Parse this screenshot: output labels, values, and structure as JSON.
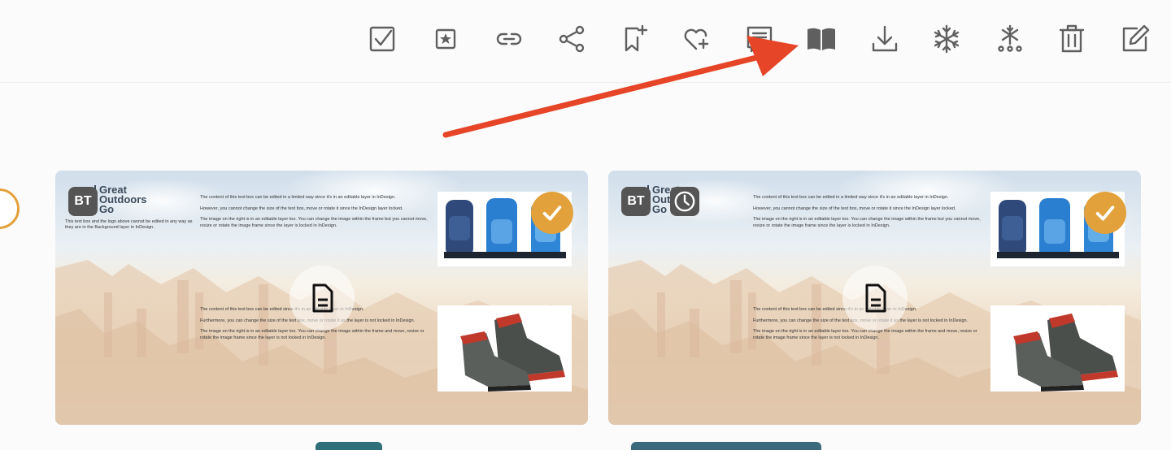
{
  "toolbar": {
    "icons": [
      {
        "name": "select-checkbox-icon"
      },
      {
        "name": "favorite-star-icon"
      },
      {
        "name": "link-icon"
      },
      {
        "name": "share-icon"
      },
      {
        "name": "add-to-collection-icon"
      },
      {
        "name": "add-to-favorites-icon"
      },
      {
        "name": "details-list-icon"
      },
      {
        "name": "open-book-icon"
      },
      {
        "name": "download-icon"
      },
      {
        "name": "freeze-icon"
      },
      {
        "name": "unfreeze-icon"
      },
      {
        "name": "delete-trash-icon"
      },
      {
        "name": "edit-icon"
      }
    ],
    "icon_color": "#5f5f5f"
  },
  "annotation": {
    "arrow_color": "#e64527",
    "points_to": "open-book-icon"
  },
  "accent_color": "#e2a13a",
  "cards": [
    {
      "user_initials": "BT",
      "selected": true,
      "has_clock": false,
      "file_type_icon": "document-icon",
      "logo_text": [
        "Great",
        "Outdoors",
        "Go"
      ],
      "logo_note": "This text box and the logo above cannot be edited in any way as they are in the Background layer in InDesign.",
      "text_top": [
        "The content of this text box can be edited in a limited way since it's in an editable layer in InDesign.",
        "However, you cannot change the size of the text box, move or rotate it since the InDesign layer locked.",
        "The image on the right is in an editable layer too. You can change the image within the frame but you cannot move, resize or rotate the image frame since the layer is locked in InDesign."
      ],
      "text_bottom": [
        "The content of this text box can be edited since it's in an editable layer in InDesign.",
        "Furthermore, you can change the size of the text box, move or rotate it as the layer is not locked in InDesign.",
        "The image on the right is in an editable layer too. You can change the image within the frame and move, resize or rotate the image frame since the layer is not locked in InDesign."
      ]
    },
    {
      "user_initials": "BT",
      "selected": true,
      "has_clock": true,
      "file_type_icon": "document-icon",
      "logo_text": [
        "Great",
        "Outdoors",
        "Go"
      ],
      "logo_note": "",
      "text_top": [
        "The content of this text box can be edited in a limited way since it's in an editable layer in InDesign.",
        "However, you cannot change the size of the text box, move or rotate it since the InDesign layer locked.",
        "The image on the right is in an editable layer too. You can change the image within the frame but you cannot move, resize or rotate the image frame since the layer is locked in InDesign."
      ],
      "text_bottom": [
        "The content of this text box can be edited since it's in an editable layer in InDesign.",
        "Furthermore, you can change the size of the text box, move or rotate it as the layer is not locked in InDesign.",
        "The image on the right is in an editable layer too. You can change the image within the frame and move, resize or rotate the image frame since the layer is not locked in InDesign."
      ]
    }
  ]
}
